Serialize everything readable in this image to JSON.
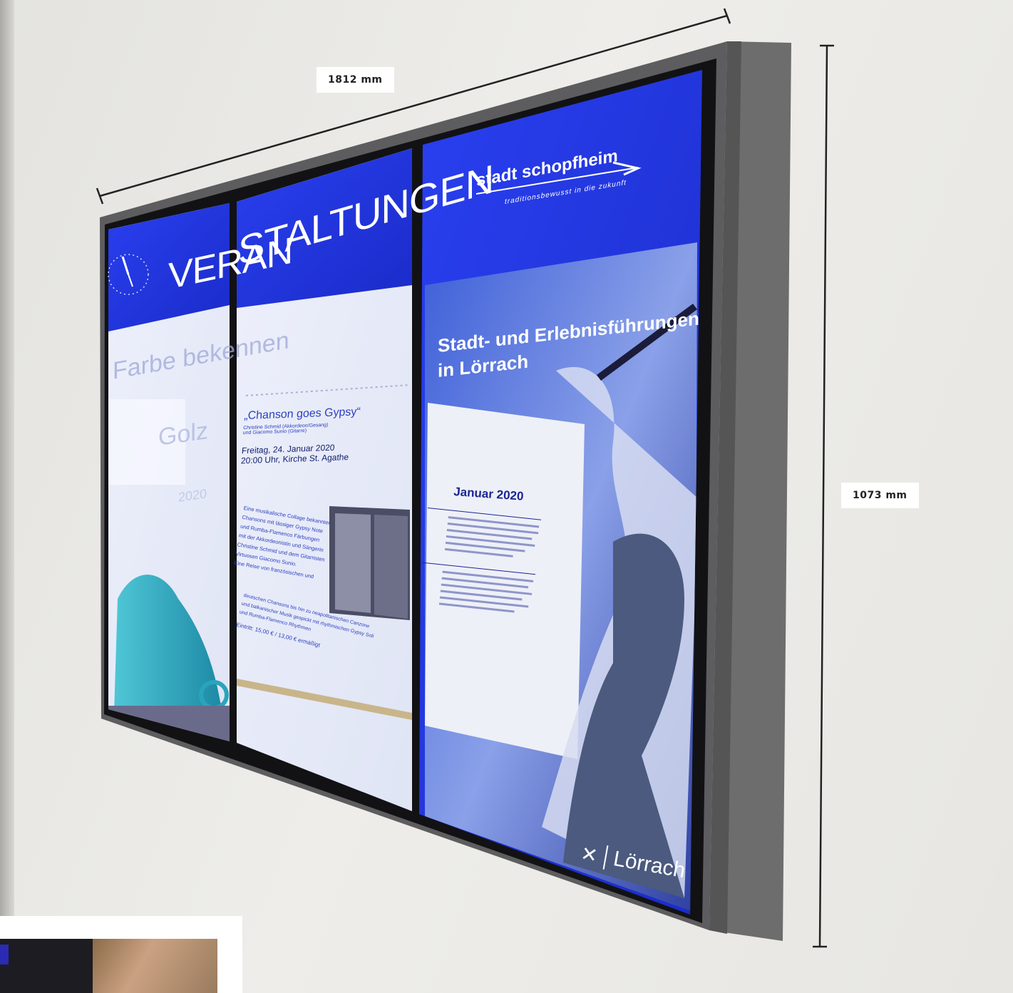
{
  "dimensions": {
    "width_label": "1812 mm",
    "height_label": "1073 mm"
  },
  "panel_left": {
    "title_part": "VERAN",
    "faded_line_1": "Farbe bekennen",
    "faded_line_2": "Golz",
    "faded_line_3": "2020"
  },
  "panel_middle": {
    "title_part": "STALTUNGEN",
    "event_title": "„Chanson goes Gypsy“",
    "performers_1": "Christine Schmid (Akkordeon/Gesang)",
    "performers_2": "und Giacomo Sunio (Gitarre)",
    "date": "Freitag, 24. Januar 2020",
    "time_place": "20:00 Uhr, Kirche St. Agathe",
    "desc_lines": [
      "Eine musikalische Collage bekannter",
      "Chansons mit lässiger Gypsy Note",
      "und Rumba-Flamenco Färbungen",
      "mit der Akkordeonistin und Sängerin",
      "Christine Schmid und dem Gitarristen",
      "Virtuosen Giacomo Sunio.",
      "Eine Reise von französischen und",
      "deutschen Chansons bis hin zu neapolitanischen Canzone",
      "und balkanischer Musik gespickt mit rhythmischen Gypsy Soli",
      "und Rumba-Flamenco Rhythmen"
    ],
    "admission": "Eintritt: 15,00 € / 13,00 € ermäßigt"
  },
  "panel_right": {
    "logo_main": "stadt schopfheim",
    "logo_tagline": "traditionsbewusst in die zukunft",
    "headline_1": "Stadt- und Erlebnisführungen",
    "headline_2": "in Lörrach",
    "month": "Januar 2020",
    "footer_logo": "Lörrach"
  },
  "colors": {
    "screen_blue": "#1f33e0",
    "frame_gray": "#6b6b6b",
    "bezel": "#121214"
  }
}
